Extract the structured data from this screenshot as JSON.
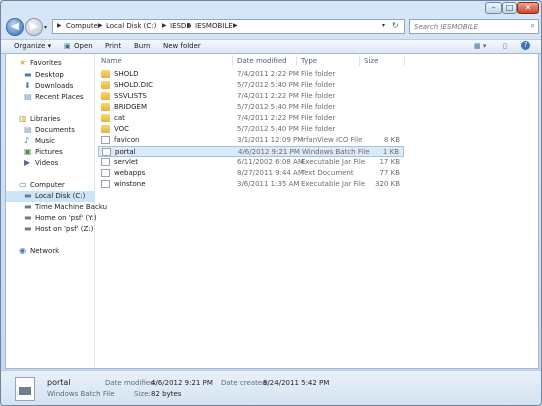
{
  "window": {
    "controls": {
      "minimize": "–",
      "maximize": "□",
      "close": "✕"
    }
  },
  "nav_buttons": {
    "back": "◀",
    "forward": "▶"
  },
  "breadcrumb": [
    "Computer",
    "Local Disk (C:)",
    "IESDB",
    "IESMOBILE"
  ],
  "search": {
    "placeholder": "Search IESMOBILE"
  },
  "toolbar": {
    "organize": "Organize ▾",
    "open": "Open",
    "print": "Print",
    "burn": "Burn",
    "new_folder": "New folder"
  },
  "sidebar": {
    "favorites_header": "Favorites",
    "favorites": [
      "Desktop",
      "Downloads",
      "Recent Places"
    ],
    "libraries_header": "Libraries",
    "libraries": [
      "Documents",
      "Music",
      "Pictures",
      "Videos"
    ],
    "computer_header": "Computer",
    "computer": [
      "Local Disk (C:)",
      "Time Machine Backu",
      "Home on 'psf' (Y:)",
      "Host on 'psf' (Z:)"
    ],
    "network": "Network"
  },
  "columns": {
    "name": "Name",
    "date": "Date modified",
    "type": "Type",
    "size": "Size"
  },
  "files": [
    {
      "name": "SHOLD",
      "date": "7/4/2011 2:22 PM",
      "type": "File folder",
      "size": "",
      "kind": "folder"
    },
    {
      "name": "SHOLD.DIC",
      "date": "5/7/2012 5:40 PM",
      "type": "File folder",
      "size": "",
      "kind": "folder"
    },
    {
      "name": "SSVLISTS",
      "date": "7/4/2011 2:22 PM",
      "type": "File folder",
      "size": "",
      "kind": "folder"
    },
    {
      "name": "BRIDGEM",
      "date": "5/7/2012 5:40 PM",
      "type": "File folder",
      "size": "",
      "kind": "folder"
    },
    {
      "name": "cat",
      "date": "7/4/2011 2:22 PM",
      "type": "File folder",
      "size": "",
      "kind": "folder"
    },
    {
      "name": "VOC",
      "date": "5/7/2012 5:40 PM",
      "type": "File folder",
      "size": "",
      "kind": "folder"
    },
    {
      "name": "favicon",
      "date": "3/1/2011 12:09 PM",
      "type": "IrfanView ICO File",
      "size": "8 KB",
      "kind": "file"
    },
    {
      "name": "portal",
      "date": "4/6/2012 9:21 PM",
      "type": "Windows Batch File",
      "size": "1 KB",
      "kind": "file"
    },
    {
      "name": "servlet",
      "date": "6/11/2002 6:08 AM",
      "type": "Executable Jar File",
      "size": "17 KB",
      "kind": "file"
    },
    {
      "name": "webapps",
      "date": "8/27/2011 9:44 AM",
      "type": "Text Document",
      "size": "77 KB",
      "kind": "file"
    },
    {
      "name": "winstone",
      "date": "3/6/2011 1:35 AM",
      "type": "Executable Jar File",
      "size": "320 KB",
      "kind": "file"
    }
  ],
  "selected_index": 7,
  "details": {
    "name": "portal",
    "type": "Windows Batch File",
    "date_modified_label": "Date modified:",
    "date_modified": "4/6/2012 9:21 PM",
    "size_label": "Size:",
    "size": "82 bytes",
    "date_created_label": "Date created:",
    "date_created": "8/24/2011 5:42 PM"
  }
}
